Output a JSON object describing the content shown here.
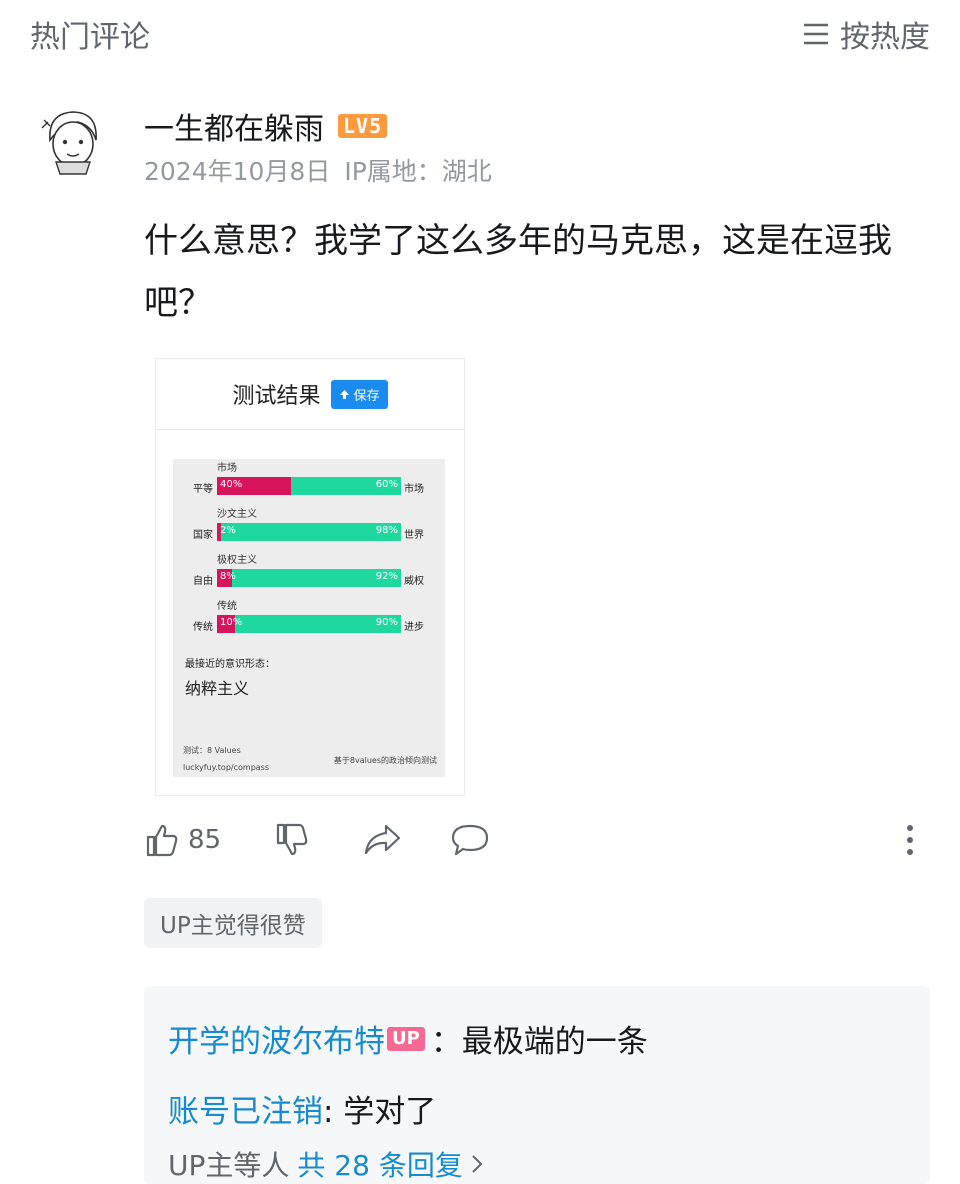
{
  "header": {
    "title": "热门评论",
    "sort_label": "按热度"
  },
  "comment": {
    "username": "一生都在躲雨",
    "level": "LV5",
    "date": "2024年10月8日",
    "ip": "IP属地：湖北",
    "text": "什么意思？我学了这么多年的马克思，这是在逗我吧？",
    "likes": "85",
    "up_liked": "UP主觉得很赞"
  },
  "result_card": {
    "title": "测试结果",
    "save_label": "保存",
    "axes": [
      {
        "axis_label": "市场",
        "left_label": "平等",
        "right_label": "市场",
        "left_pct": "40%",
        "right_pct": "60%",
        "left_value": 40
      },
      {
        "axis_label": "沙文主义",
        "left_label": "国家",
        "right_label": "世界",
        "left_pct": "2%",
        "right_pct": "98%",
        "left_value": 2
      },
      {
        "axis_label": "极权主义",
        "left_label": "自由",
        "right_label": "威权",
        "left_pct": "8%",
        "right_pct": "92%",
        "left_value": 8
      },
      {
        "axis_label": "传统",
        "left_label": "传统",
        "right_label": "进步",
        "left_pct": "10%",
        "right_pct": "90%",
        "left_value": 10
      }
    ],
    "closest_label": "最接近的意识形态：",
    "ideology": "纳粹主义",
    "footer_test": "测试：8 Values",
    "footer_url": "luckyfuy.top/compass",
    "footer_note": "基于8values的政治倾向测试",
    "colors": {
      "left": "#d8145c",
      "right": "#1fd8a0"
    }
  },
  "replies": [
    {
      "name": "开学的波尔布特",
      "badge": "UP",
      "text": "：最极端的一条"
    },
    {
      "name": "账号已注销",
      "badge": "",
      "text": ": 学对了"
    }
  ],
  "more_replies": {
    "prefix": "UP主等人",
    "count": "共 28 条回复"
  },
  "icons": [
    "sort-icon",
    "like-icon",
    "dislike-icon",
    "share-icon",
    "reply-icon",
    "more-icon",
    "chevron-right-icon"
  ]
}
